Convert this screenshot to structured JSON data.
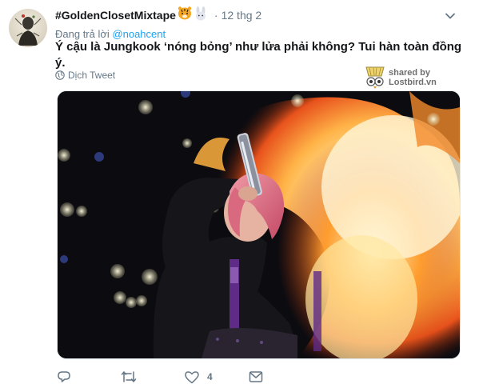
{
  "tweet": {
    "display_name": "#GoldenClosetMixtape",
    "emojis": [
      "tiger-emoji",
      "rabbit-emoji"
    ],
    "separator": "·",
    "date": "12 thg 2",
    "reply_prefix": "Đang trả lời",
    "reply_handle": "@noahcent",
    "text": "Ý cậu là Jungkook ‘nóng bỏng’ như lửa phải không? Tui hàn toàn đồng ý.",
    "translate_label": "Dịch Tweet",
    "watermark": {
      "line1": "shared by",
      "line2": "Lostbird.vn"
    },
    "actions": {
      "reply_icon": "reply-icon",
      "retweet_icon": "retweet-icon",
      "like_icon": "heart-icon",
      "like_count": "4",
      "message_icon": "envelope-icon"
    }
  },
  "colors": {
    "link": "#1da1f2",
    "secondary": "#657786",
    "primary_text": "#14171a"
  }
}
